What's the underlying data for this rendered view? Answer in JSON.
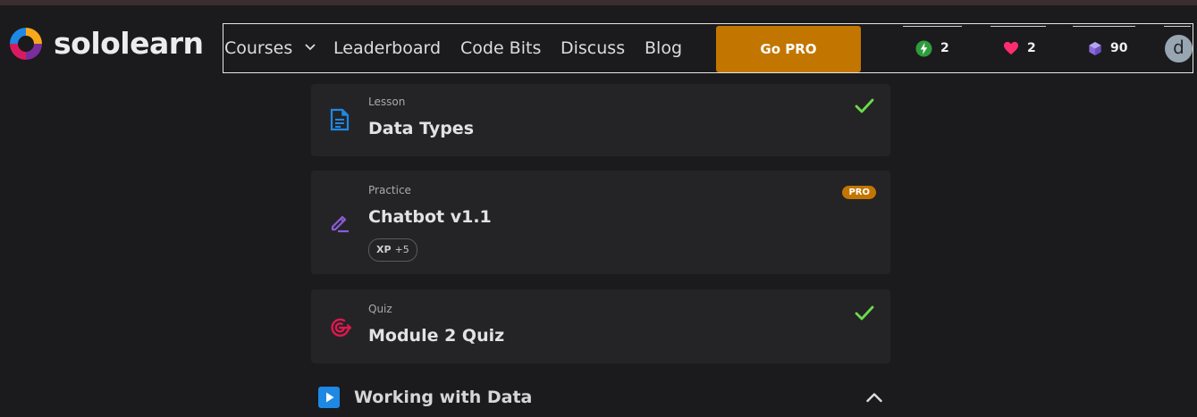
{
  "brand": {
    "name": "sololearn",
    "colors": [
      "#f7a81b",
      "#1e88e5",
      "#d81b60",
      "#7b2d9c"
    ]
  },
  "nav": {
    "items": [
      {
        "label": "Courses"
      },
      {
        "label": "Leaderboard"
      },
      {
        "label": "Code Bits"
      },
      {
        "label": "Discuss"
      },
      {
        "label": "Blog"
      }
    ],
    "go_pro_label": "Go PRO"
  },
  "stats": {
    "streak": {
      "icon": "lightning-icon",
      "value": "2",
      "color": "#2e9c3c"
    },
    "hearts": {
      "icon": "heart-icon",
      "value": "2",
      "color": "#ff2d6f"
    },
    "gems": {
      "icon": "gem-icon",
      "value": "90",
      "color": "#8a6bd8"
    }
  },
  "user": {
    "avatar_letter": "d"
  },
  "cards": [
    {
      "kind": "Lesson",
      "title": "Data Types",
      "icon": "document-icon",
      "completed": true
    },
    {
      "kind": "Practice",
      "title": "Chatbot v1.1",
      "icon": "pencil-icon",
      "badge": "PRO",
      "xp_label": "XP",
      "xp_value": "+5"
    },
    {
      "kind": "Quiz",
      "title": "Module 2 Quiz",
      "icon": "target-icon",
      "completed": true
    }
  ],
  "section": {
    "title": "Working with Data",
    "icon": "play-icon",
    "expanded": true
  }
}
